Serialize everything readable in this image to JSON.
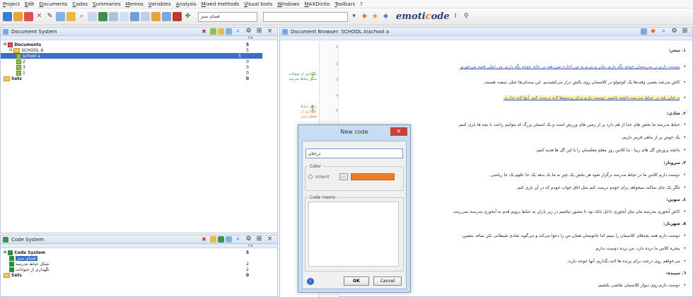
{
  "menu": [
    "Project",
    "Edit",
    "Documents",
    "Codes",
    "Summaries",
    "Memos",
    "Variables",
    "Analysis",
    "Mixed methods",
    "Visual tools",
    "Windows",
    "MAXDictio",
    "Toolbars",
    "?"
  ],
  "toolbar": {
    "combo_value": "فضای سبز",
    "logo_prefix": "emoti",
    "logo_accent": "c",
    "logo_suffix": "ode"
  },
  "document_system": {
    "title": "Document System",
    "col_hint": "0  8",
    "rows": [
      {
        "label": "Documents",
        "count": "5"
      },
      {
        "label": "SCHOOL A",
        "count": "5"
      },
      {
        "label": "school a",
        "count": "5"
      },
      {
        "label": "2",
        "count": "0"
      },
      {
        "label": "3",
        "count": "0"
      },
      {
        "label": "1",
        "count": "0"
      },
      {
        "label": "Sets",
        "count": "0"
      }
    ]
  },
  "code_system": {
    "title": "Code System",
    "col_hint": "0  8",
    "rows": [
      {
        "label": "Code System",
        "count": "5"
      },
      {
        "label": "فضای سبز",
        "count": ""
      },
      {
        "label": "شکل حیاط مدرسه",
        "count": "2"
      },
      {
        "label": "نگهداری از حیوانات",
        "count": "2"
      },
      {
        "label": "Sets",
        "count": "0"
      }
    ]
  },
  "document_browser": {
    "title": "Document Browser: SCHOOL A\\school a",
    "margin_codes": [
      {
        "label": "نگهداری از حیوانات\nشکل حیاط مدرسه"
      },
      {
        "label": "شکل حیاط\nنگهداری از\nفضای سبز"
      }
    ],
    "line_numbers": [
      "1",
      "2",
      "3",
      "4",
      "5"
    ],
    "lines": [
      {
        "text": "١.  سحر:",
        "type": "heading"
      },
      {
        "text": "دوست دارم در مدرسمان جوجه نگه دارم. مادر و پدرم به من اجازه نمی‌دهند در خانه جوجه نگه دارم. من خیلی قصه می‌خورم.",
        "type": "bullet"
      },
      {
        "text": "کاش می‌شد بعضی وقت‌ها یک کوچولو در کلاسمان روی بالش دراز می‌کشیدیم. این صندلی‌ها خیلی سفت هستند.",
        "type": "bullet"
      },
      {
        "text": "درختان بلند در حیاط مدرسه داشته باشیم. دوست دارم برای پرستوها لانه درست کنم. آنها لانه ندارند.",
        "type": "bullet"
      },
      {
        "text": "٢.  شادی:",
        "type": "heading"
      },
      {
        "text": "حیاط مدرسه ما بخش های جدا از هم دارد پر از زمین های ورزش است و یک استخر بزرگ که بتوانیم راحت با بچه ها بازی کنیم.",
        "type": "bullet"
      },
      {
        "text": "یک حوض پر از ماهی قرمز داریم.",
        "type": "bullet"
      },
      {
        "text": "باغچه پرورش گل های زیبا . ما کلاس روز معلم معلممان را با این گل ها هدیه کنیم.",
        "type": "bullet"
      },
      {
        "text": "٣.  سروناز:",
        "type": "heading"
      },
      {
        "text": "دوست دارم کلاس ما در حیاط مدرسه برگزار شود هر بخش یک چیز به ما یاد بدهد یک جا علوم یک جا ریاضی.",
        "type": "bullet"
      },
      {
        "text": "تلگر یک جای ساکت میخواهد برای خودم درست کنم مثل اتاق خواب خودم که در آن بازی کنم.",
        "type": "bullet"
      },
      {
        "text": "٤.  سوین:",
        "type": "heading"
      },
      {
        "text": "کاش آبخوری مدرسه مان مثل آبخوری داخل بانک بود تا مجبور نباشیم در زیر باران به حیاط برویم قدم به آبخوری مدرسه نمی‌رسد.",
        "type": "bullet"
      },
      {
        "text": "٥.  شهرناز:",
        "type": "heading"
      },
      {
        "text": "دوست دارم همه بچه‌های کلاسمان را ببینم اما خانوممان همان من را دعوا می‌کند و می‌گوید شادی شیطانی نکن صاف بنشین.",
        "type": "bullet"
      },
      {
        "text": "پنجره کلاس ما نرده دارد. من نرده دوست ندارم.",
        "type": "bullet"
      },
      {
        "text": "می‌خواهم روی درخت برای پرنده ها لانه بگذارم، آنها جوجه دارند.",
        "type": "bullet"
      },
      {
        "text": "٦.  سپیده:",
        "type": "heading"
      },
      {
        "text": "دوست دارم روی دیوار کلاسمان نقاشی بکشیم.",
        "type": "bullet"
      }
    ]
  },
  "dialog": {
    "title": "New code",
    "name_value": "درختان",
    "color_legend": "Color",
    "inherit_label": "Inherit",
    "memo_legend": "Code memo",
    "ok_label": "OK",
    "cancel_label": "Cancel",
    "swatch_color": "#f07d1f"
  },
  "colors": {
    "selection": "#3b6fc4",
    "panel_border": "#b9c7da",
    "green_code": "#2a8f3a"
  }
}
